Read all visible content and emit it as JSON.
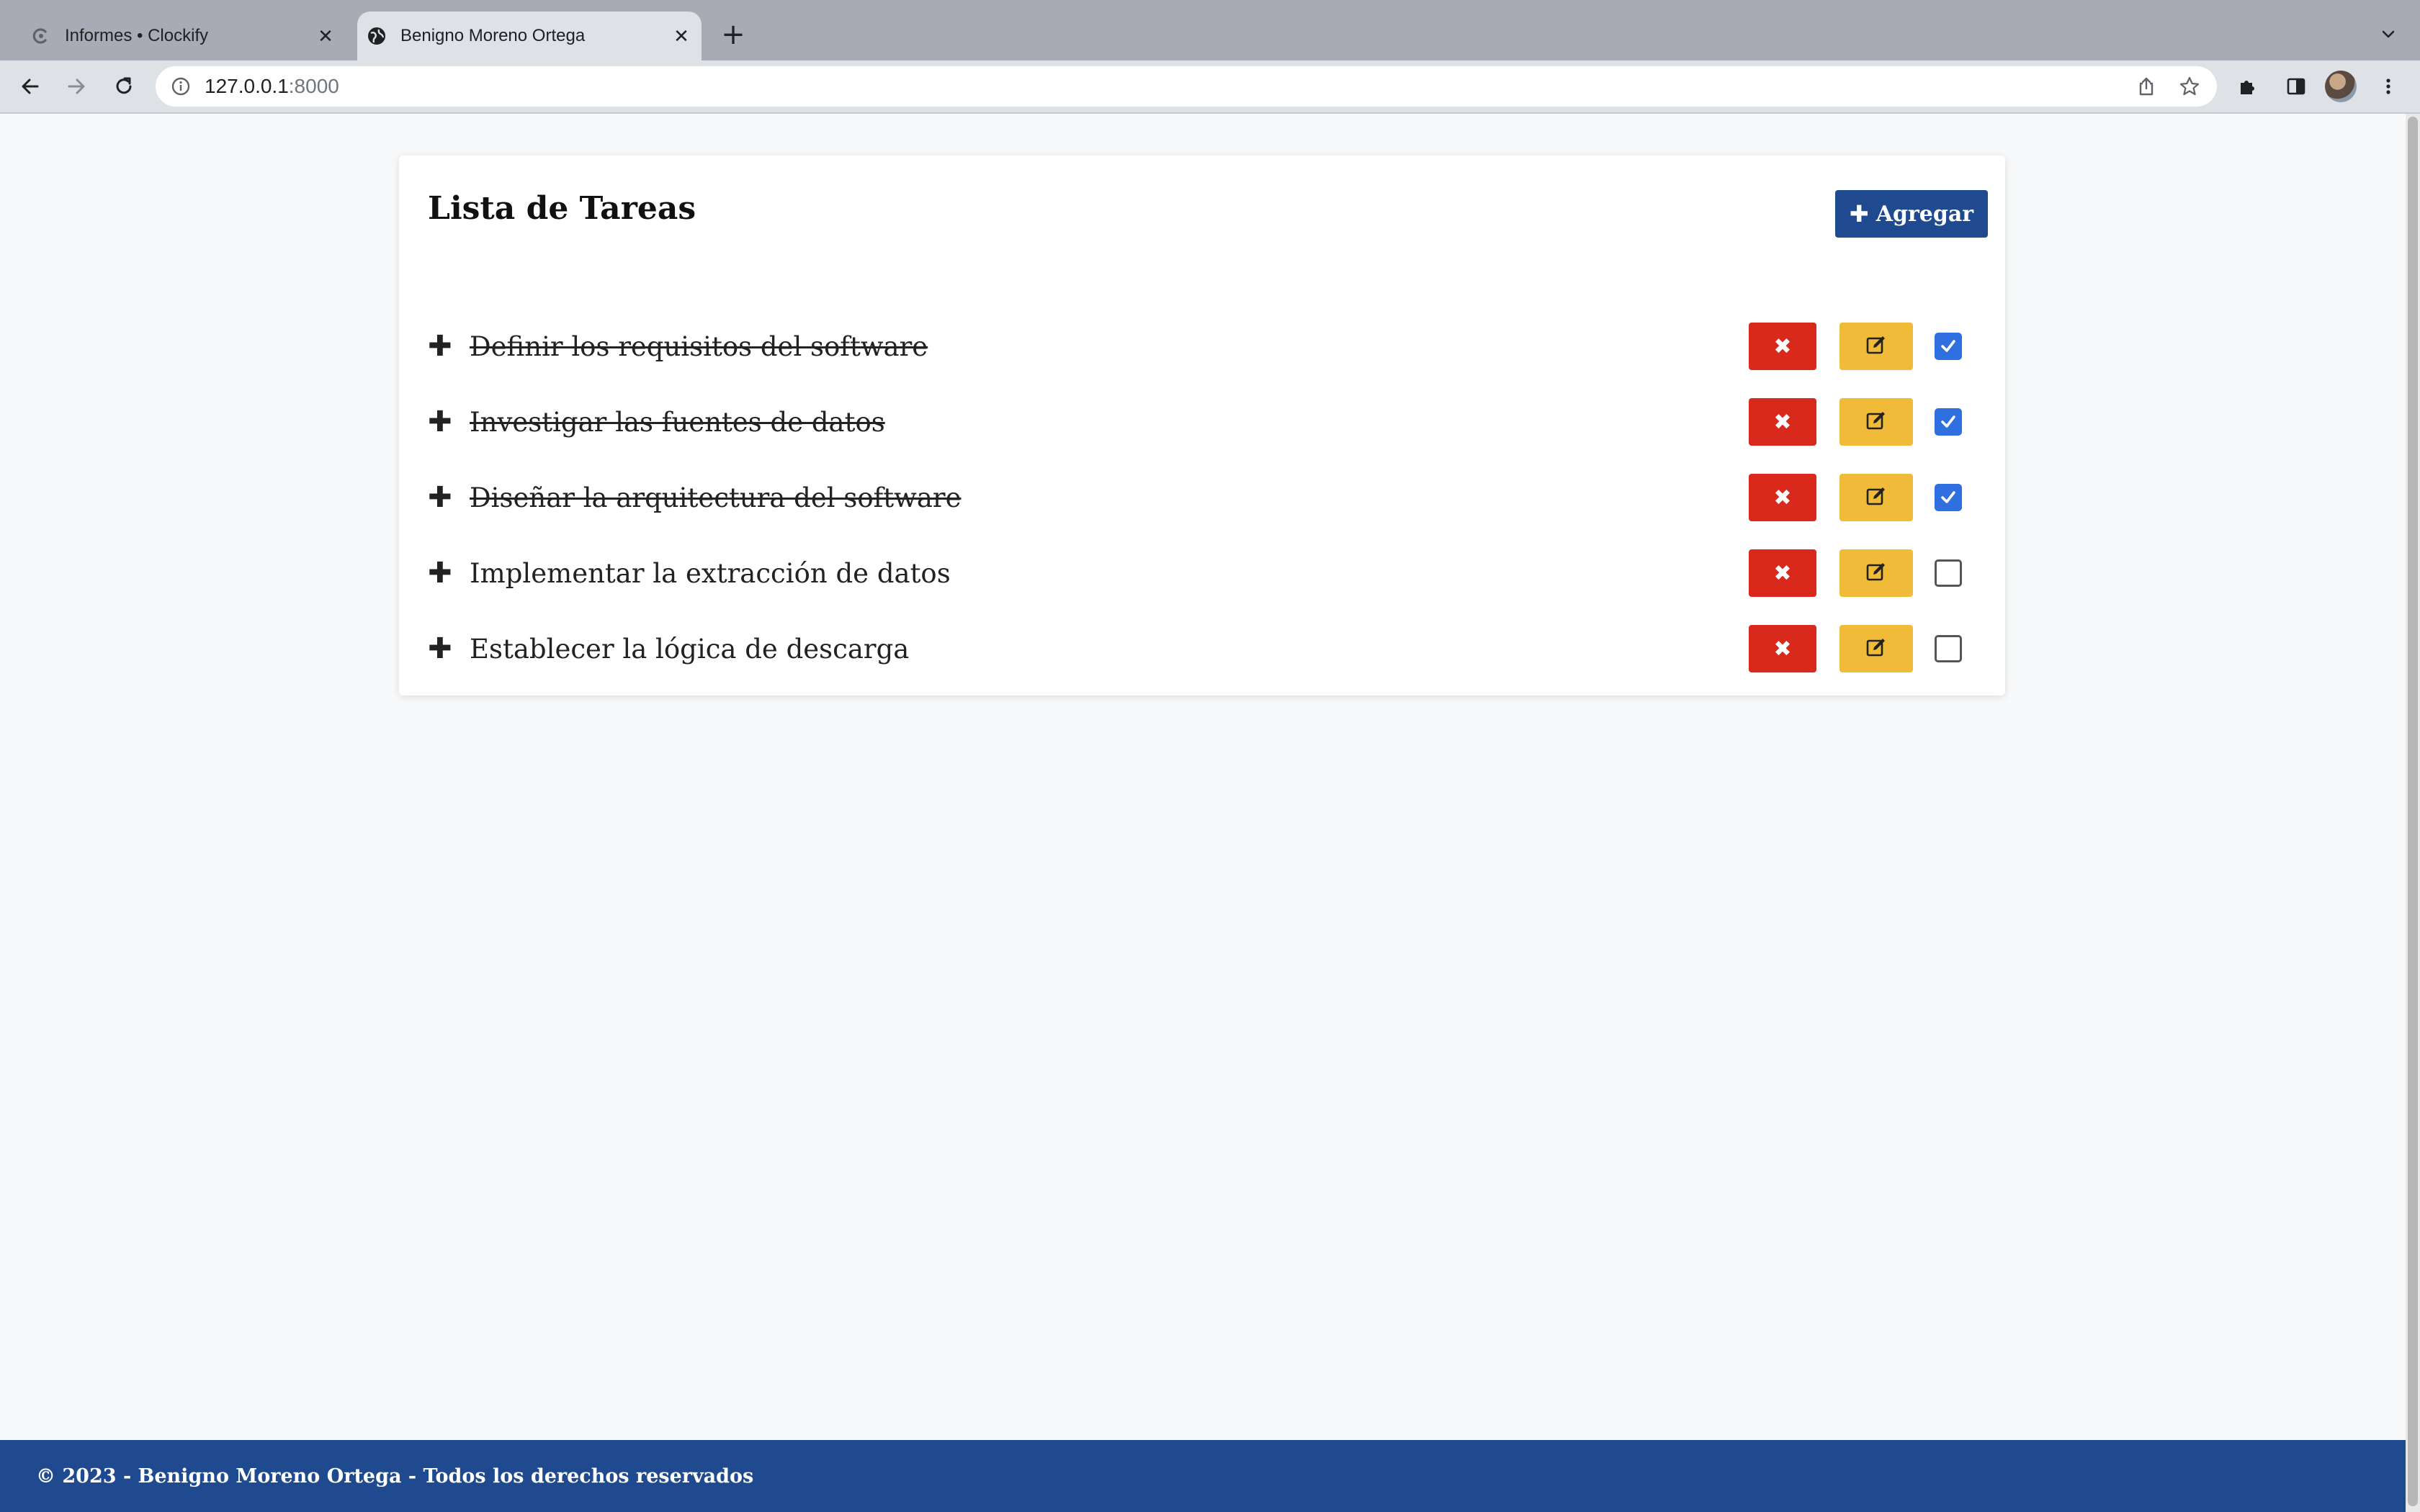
{
  "browser": {
    "tabs": [
      {
        "title": "Informes • Clockify",
        "icon": "clockify-icon",
        "active": false
      },
      {
        "title": "Benigno Moreno Ortega",
        "icon": "globe-icon",
        "active": true
      }
    ],
    "address": {
      "host": "127.0.0.1",
      "port": ":8000"
    }
  },
  "card": {
    "title": "Lista de Tareas",
    "add_label": "Agregar"
  },
  "tasks": [
    {
      "text": "Definir los requisitos del software",
      "done": true
    },
    {
      "text": "Investigar las fuentes de datos",
      "done": true
    },
    {
      "text": "Diseñar la arquitectura del software",
      "done": true
    },
    {
      "text": "Implementar la extracción de datos",
      "done": false
    },
    {
      "text": "Establecer la lógica de descarga",
      "done": false
    }
  ],
  "footer": {
    "text": "© 2023 - Benigno Moreno Ortega - Todos los derechos reservados"
  },
  "colors": {
    "primary": "#1f4a8f",
    "delete": "#d9291c",
    "edit": "#f1bb3a",
    "checked": "#2f6fe0"
  }
}
